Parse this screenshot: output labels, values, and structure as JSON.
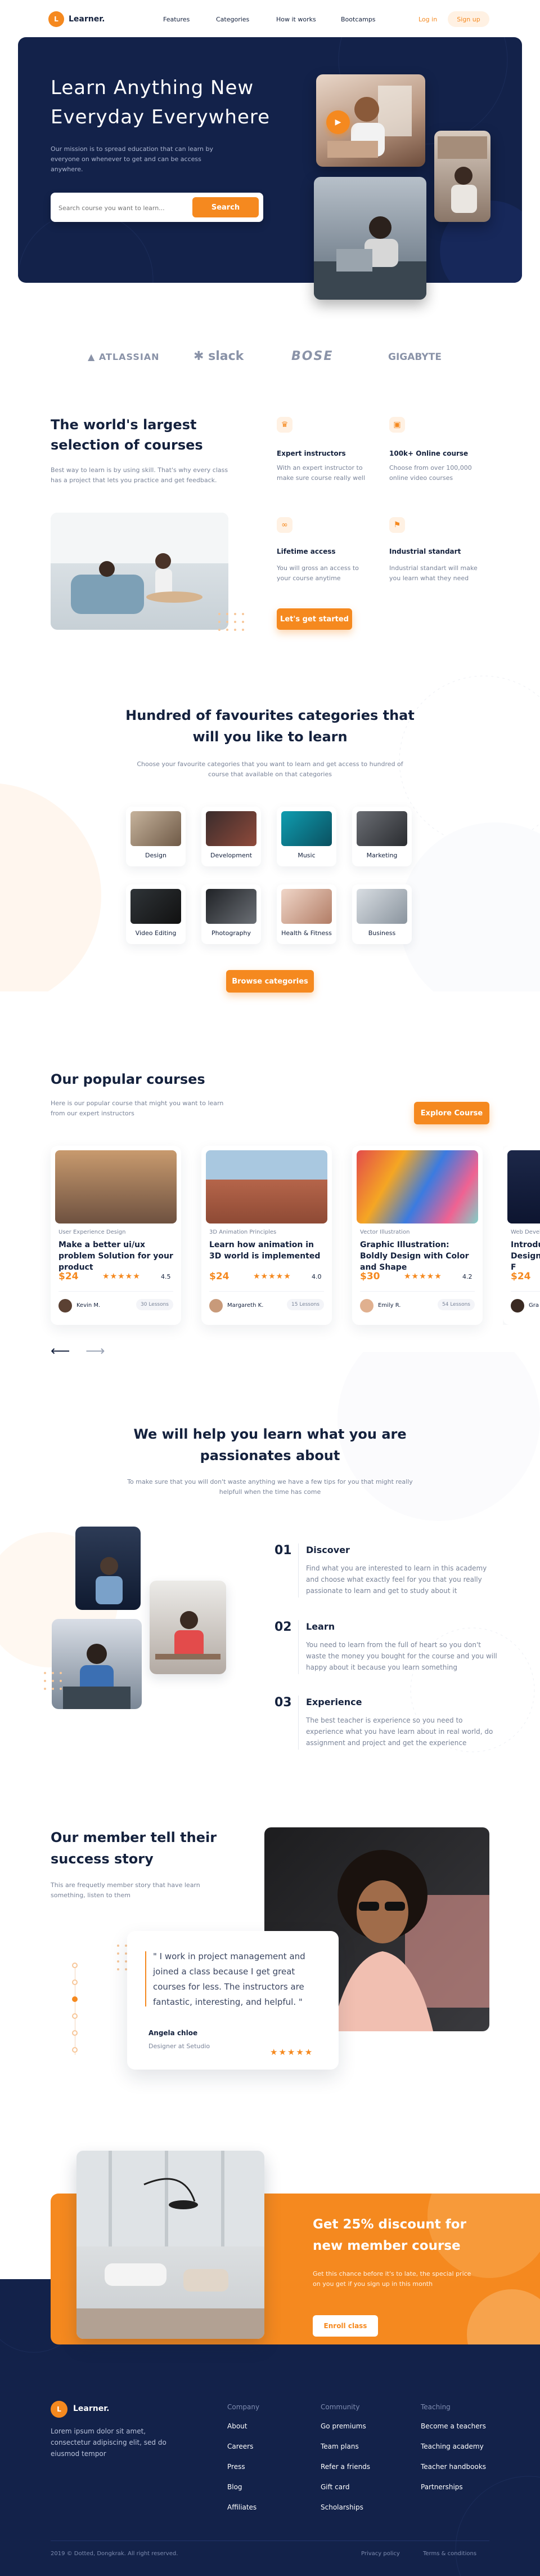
{
  "header": {
    "logo_letter": "L",
    "logo_text": "Learner.",
    "nav": [
      "Features",
      "Categories",
      "How it works",
      "Bootcamps"
    ],
    "login": "Log in",
    "signup": "Sign up"
  },
  "hero": {
    "title_line1": "Learn Anything New",
    "title_line2": "Everyday Everywhere",
    "desc": "Our mission is to spread education that can learn by everyone on whenever to get and can be access anywhere.",
    "search_placeholder": "Search course you want to learn...",
    "search_button": "Search"
  },
  "brands": [
    "ATLASSIAN",
    "slack",
    "BOSE",
    "GIGABYTE"
  ],
  "selection": {
    "title_line1": "The world's largest",
    "title_line2": "selection of courses",
    "desc": "Best way to learn is by using skill. That's why every class has a project that lets you practice and get feedback.",
    "features": [
      {
        "title": "Expert instructors",
        "desc": "With an expert instructor to make sure course really well"
      },
      {
        "title": "100k+ Online course",
        "desc": "Choose from over 100,000 online video courses"
      },
      {
        "title": "Lifetime access",
        "desc": "You will gross an access to your course anytime"
      },
      {
        "title": "Industrial standart",
        "desc": "Industrial standart will make you learn what they need"
      }
    ],
    "cta": "Let's get started"
  },
  "categories": {
    "title_line1": "Hundred of favourites categories that",
    "title_line2": "will you like to learn",
    "desc": "Choose your favourite categories that you want to learn and get access to hundred of course that available on that categories",
    "items": [
      "Design",
      "Development",
      "Music",
      "Marketing",
      "Video Editing",
      "Photography",
      "Health & Fitness",
      "Business"
    ],
    "button": "Browse categories"
  },
  "popular": {
    "title": "Our popular courses",
    "desc": "Here is our popular course that might you want to learn from our expert instructors",
    "button": "Explore Course",
    "courses": [
      {
        "category": "User Experience Design",
        "title": "Make a better ui/ux problem Solution for your product",
        "price": "$24",
        "stars": "★★★★★",
        "rating": "4.5",
        "author": "Kevin M.",
        "lessons": "30 Lessons"
      },
      {
        "category": "3D Animation Principles",
        "title": "Learn how animation in 3D world is implemented",
        "price": "$24",
        "stars": "★★★★★",
        "rating": "4.0",
        "author": "Margareth K.",
        "lessons": "15 Lessons"
      },
      {
        "category": "Vector Illustration",
        "title": "Graphic Illustration: Boldly Design with Color and Shape",
        "price": "$30",
        "stars": "★★★★★",
        "rating": "4.2",
        "author": "Emily R.",
        "lessons": "54 Lessons"
      },
      {
        "category": "Web Developm",
        "title": "Introduc Design: F",
        "price": "$24",
        "stars": "",
        "rating": "",
        "author": "Gra",
        "lessons": ""
      }
    ],
    "prev_arrow": "⟵",
    "next_arrow": "⟶"
  },
  "help": {
    "title_line1": "We will help you learn what you are",
    "title_line2": "passionates about",
    "desc": "To make sure that you will don't waste anything we have a few tips for you that might really helpfull when the time has come",
    "steps": [
      {
        "num": "01",
        "title": "Discover",
        "desc": "Find what you are interested to learn in this academy and choose what exactly feel for you that you really passionate to learn and get to study about it"
      },
      {
        "num": "02",
        "title": "Learn",
        "desc": "You need to learn from the full of heart so you don't waste the money you bought for the course and you will happy about it because you learn something"
      },
      {
        "num": "03",
        "title": "Experience",
        "desc": "The best teacher is experience so you need to experience what you have learn about in real world, do assignment and project and get the experience"
      }
    ]
  },
  "testimonial": {
    "title_line1": "Our member tell their",
    "title_line2": "success story",
    "desc": "This are frequetly member story that have learn something, listen to them",
    "quote": "\" I work in project management and joined a class because I get great courses for less. The instructors are fantastic, interesting, and helpful. \"",
    "name": "Angela chloe",
    "role": "Designer at Setudio",
    "stars": "★★★★★"
  },
  "discount": {
    "title_line1": "Get 25% discount for",
    "title_line2": "new member course",
    "desc": "Get this chance before it's to late, the special price on you get if you sign up in this month",
    "button": "Enroll class"
  },
  "footer": {
    "logo_letter": "L",
    "logo_text": "Learner.",
    "desc": "Lorem ipsum dolor sit amet, consectetur adipiscing elit, sed do eiusmod tempor",
    "columns": [
      {
        "heading": "Company",
        "links": [
          "About",
          "Careers",
          "Press",
          "Blog",
          "Affiliates"
        ]
      },
      {
        "heading": "Community",
        "links": [
          "Go premiums",
          "Team plans",
          "Refer a friends",
          "Gift card",
          "Scholarships"
        ]
      },
      {
        "heading": "Teaching",
        "links": [
          "Become a teachers",
          "Teaching academy",
          "Teacher handbooks",
          "Partnerships"
        ]
      }
    ],
    "copyright": "2019 © Dotted, Dongkrak. All right reserved.",
    "privacy": "Privacy policy",
    "terms": "Terms & conditions"
  }
}
